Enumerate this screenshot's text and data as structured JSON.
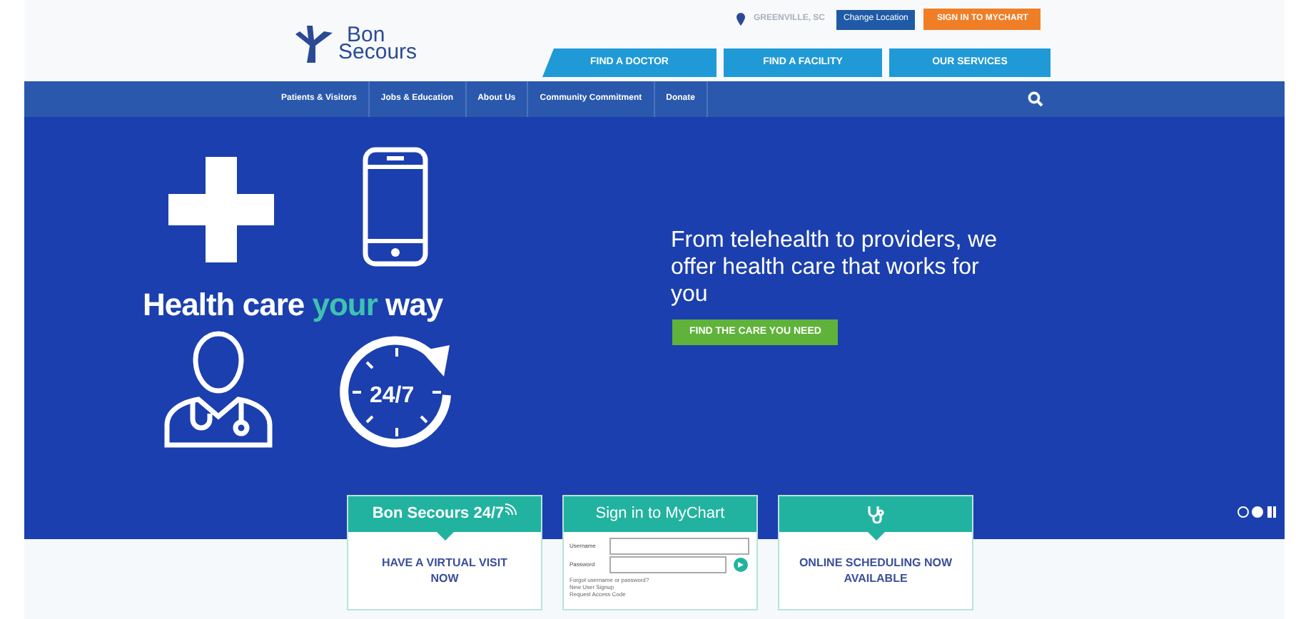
{
  "header": {
    "logo": {
      "line1": "Bon",
      "line2": "Secours"
    },
    "location": "GREENVILLE, SC",
    "change_location": "Change Location",
    "sign_in": "SIGN IN TO MYCHART",
    "tabs": [
      {
        "label": "FIND A DOCTOR"
      },
      {
        "label": "FIND A FACILITY"
      },
      {
        "label": "OUR SERVICES"
      }
    ]
  },
  "nav": {
    "items": [
      {
        "label": "Patients & Visitors"
      },
      {
        "label": "Jobs & Education"
      },
      {
        "label": "About Us"
      },
      {
        "label": "Community Commitment"
      },
      {
        "label": "Donate"
      }
    ]
  },
  "hero": {
    "headline": {
      "before": "Health care",
      "accent": "your",
      "after": "way"
    },
    "clock_label": "24/7",
    "text": "From telehealth to providers, we offer health care that works for you",
    "button": "FIND THE CARE YOU NEED",
    "slides": [
      {
        "selected": false
      },
      {
        "selected": true
      }
    ]
  },
  "cards": [
    {
      "kind": "visit",
      "title": "Bon Secours 24/7",
      "text": "HAVE A VIRTUAL VISIT NOW"
    },
    {
      "kind": "login",
      "title": "Sign in to MyChart",
      "username_label": "Username",
      "password_label": "Password",
      "links": [
        "Forgot username or password?",
        "New User Signup",
        "Request Access Code"
      ]
    },
    {
      "kind": "scheduling",
      "text": "ONLINE SCHEDULING NOW AVAILABLE"
    }
  ]
}
